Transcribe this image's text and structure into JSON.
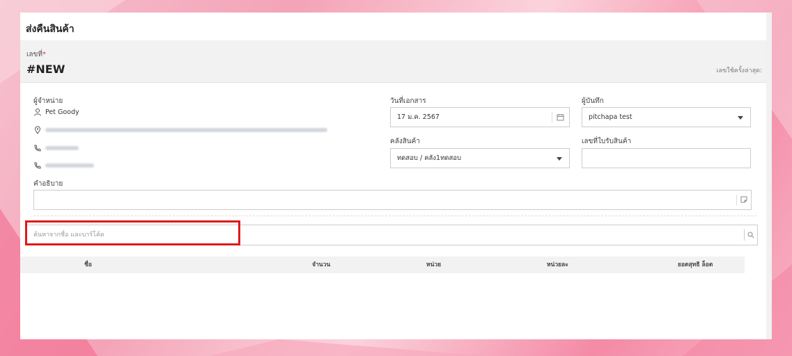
{
  "page": {
    "title": "ส่งคืนสินค้า"
  },
  "doc": {
    "no_label": "เลขที่",
    "required_mark": "*",
    "no_value": "#NEW",
    "last_used_label": "เลขใช้ครั้งล่าสุด:"
  },
  "supplier": {
    "label": "ผู้จำหน่าย",
    "name": "Pet Goody"
  },
  "doc_date": {
    "label": "วันที่เอกสาร",
    "value": "17 ม.ค. 2567"
  },
  "recorder": {
    "label": "ผู้บันทึก",
    "value": "pitchapa test"
  },
  "warehouse": {
    "label": "คลังสินค้า",
    "value": "ทดสอบ / คลัง1ทดสอบ"
  },
  "receipt_no": {
    "label": "เลขที่ใบรับสินค้า",
    "value": ""
  },
  "description": {
    "label": "คำอธิบาย",
    "value": ""
  },
  "search": {
    "placeholder": "ค้นหาจากชื่อ และบาร์โค้ด"
  },
  "table": {
    "columns": [
      "ชื่อ",
      "จำนวน",
      "หน่วย",
      "หน่วยละ",
      "ยอดสุทธิ ล็อต"
    ]
  },
  "colors": {
    "highlight": "#e01818",
    "required": "#e53935"
  }
}
